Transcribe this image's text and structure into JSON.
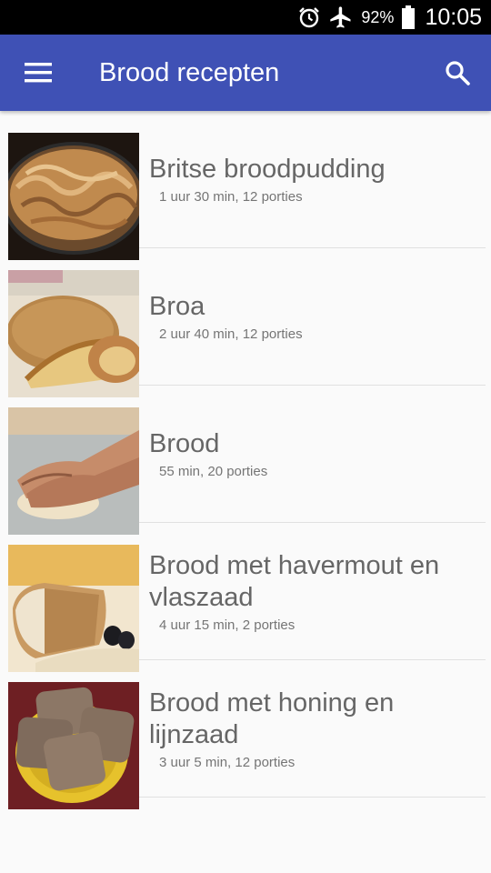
{
  "status_bar": {
    "icons": [
      "alarm-icon",
      "airplane-mode-icon",
      "battery-icon"
    ],
    "battery_percent": "92%",
    "time": "10:05"
  },
  "app_bar": {
    "title": "Brood recepten",
    "icons": [
      "menu-icon",
      "search-icon"
    ],
    "color": "#3f51b5"
  },
  "recipes": [
    {
      "title": "Britse broodpudding",
      "meta": "1 uur 30 min, 12 porties"
    },
    {
      "title": "Broa",
      "meta": "2 uur 40 min, 12 porties"
    },
    {
      "title": "Brood",
      "meta": "55 min, 20 porties"
    },
    {
      "title": "Brood met havermout en vlaszaad",
      "meta": "4 uur 15 min, 2 porties"
    },
    {
      "title": "Brood met honing en lijnzaad",
      "meta": "3 uur 5 min, 12 porties"
    }
  ]
}
